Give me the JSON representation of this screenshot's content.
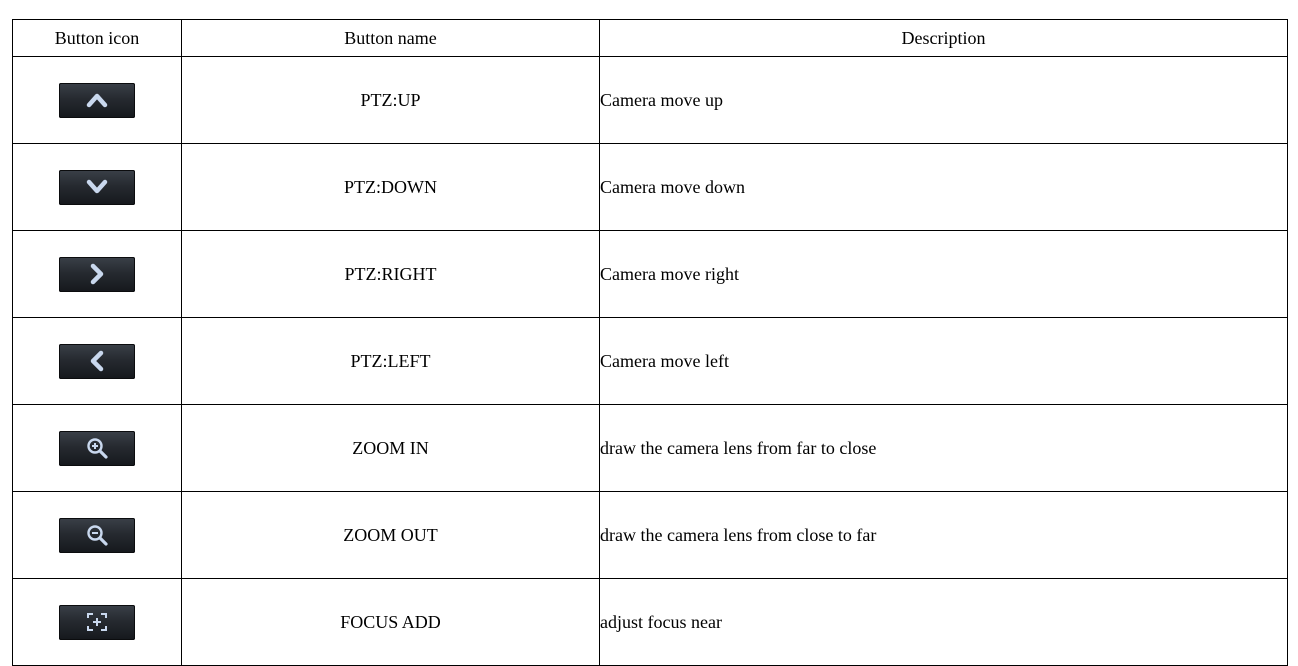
{
  "headers": [
    "Button icon",
    "Button name",
    "Description"
  ],
  "rows": [
    {
      "icon": "chevron-up-icon",
      "name": "PTZ:UP",
      "description": "Camera move up"
    },
    {
      "icon": "chevron-down-icon",
      "name": "PTZ:DOWN",
      "description": "Camera move down"
    },
    {
      "icon": "chevron-right-icon",
      "name": "PTZ:RIGHT",
      "description": "Camera move right"
    },
    {
      "icon": "chevron-left-icon",
      "name": "PTZ:LEFT",
      "description": "Camera move left"
    },
    {
      "icon": "zoom-in-icon",
      "name": "ZOOM IN",
      "description": "draw the camera lens from far to close"
    },
    {
      "icon": "zoom-out-icon",
      "name": "ZOOM OUT",
      "description": "draw the camera lens from close to far"
    },
    {
      "icon": "focus-add-icon",
      "name": "FOCUS ADD",
      "description": "adjust focus near"
    }
  ],
  "colors": {
    "button_bg": "#262a30",
    "icon_glyph": "#c9d8ee",
    "grid_line": "#000000"
  }
}
